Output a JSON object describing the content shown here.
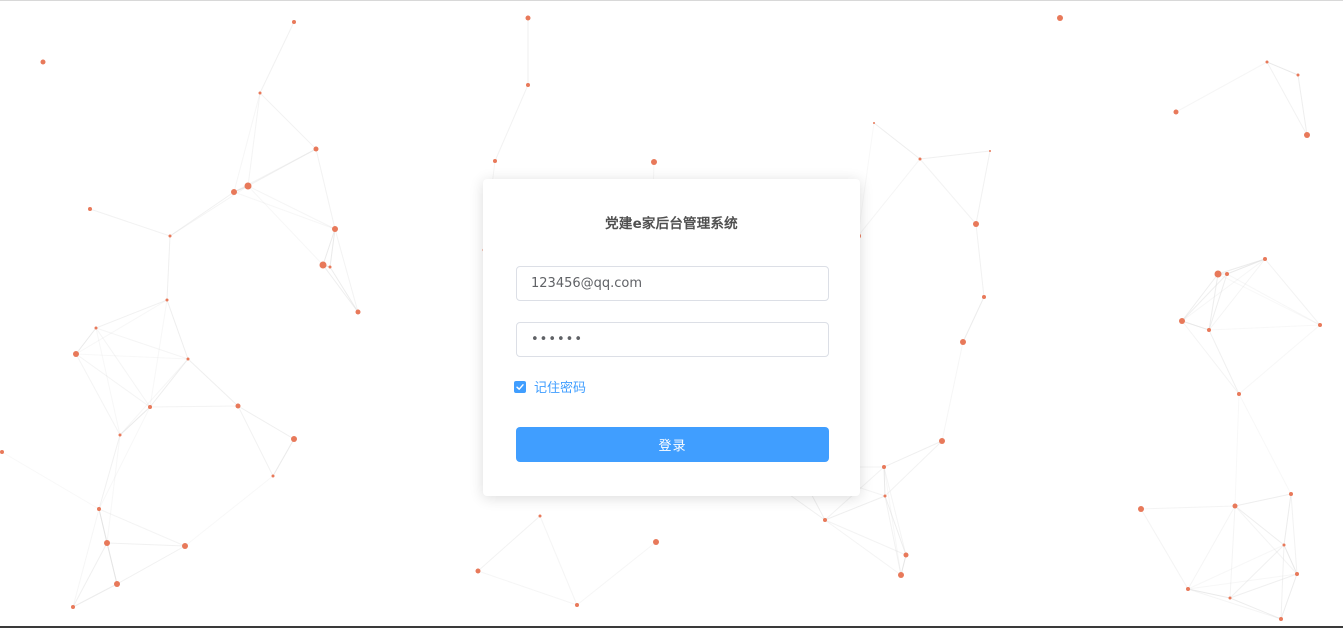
{
  "login": {
    "title": "党建e家后台管理系统",
    "username_value": "123456@qq.com",
    "password_value": "123456",
    "remember_label": "记住密码",
    "remember_checked": true,
    "submit_label": "登录"
  },
  "theme": {
    "accent": "#409eff",
    "node_color": "#e8795a",
    "line_color": "#d9d9d9"
  },
  "icons": {
    "checkbox_mark": "check-icon"
  }
}
